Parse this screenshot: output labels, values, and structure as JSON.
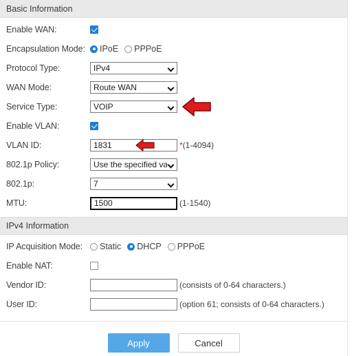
{
  "sections": {
    "basic": {
      "title": "Basic Information",
      "rows": {
        "enable_wan": {
          "label": "Enable WAN:",
          "checked": true
        },
        "encapsulation_mode": {
          "label": "Encapsulation Mode:",
          "options": [
            "IPoE",
            "PPPoE"
          ],
          "selected": "IPoE"
        },
        "protocol_type": {
          "label": "Protocol Type:",
          "value": "IPv4"
        },
        "wan_mode": {
          "label": "WAN Mode:",
          "value": "Route WAN"
        },
        "service_type": {
          "label": "Service Type:",
          "value": "VOIP"
        },
        "enable_vlan": {
          "label": "Enable VLAN:",
          "checked": true
        },
        "vlan_id": {
          "label": "VLAN ID:",
          "value": "1831",
          "asterisk": "*",
          "hint": "(1-4094)"
        },
        "dot1p_policy": {
          "label": "802.1p Policy:",
          "value": "Use the specified val"
        },
        "dot1p": {
          "label": "802.1p:",
          "value": "7"
        },
        "mtu": {
          "label": "MTU:",
          "value": "1500",
          "hint": "(1-1540)"
        }
      }
    },
    "ipv4": {
      "title": "IPv4 Information",
      "rows": {
        "ip_acquisition_mode": {
          "label": "IP Acquisition Mode:",
          "options": [
            "Static",
            "DHCP",
            "PPPoE"
          ],
          "selected": "DHCP"
        },
        "enable_nat": {
          "label": "Enable NAT:",
          "checked": false
        },
        "vendor_id": {
          "label": "Vendor ID:",
          "value": "",
          "hint": "(consists of 0-64 characters.)"
        },
        "user_id": {
          "label": "User ID:",
          "value": "",
          "hint": "(option 61; consists of 0-64 characters.)"
        }
      }
    }
  },
  "buttons": {
    "apply": "Apply",
    "cancel": "Cancel"
  },
  "annotations": {
    "service_type_arrow": "left-arrow-annotation",
    "vlan_id_arrow": "left-arrow-annotation"
  },
  "colors": {
    "accent": "#1b7fd4",
    "primary_button": "#54a8e8",
    "annotation_red": "#e01b1b",
    "section_header_bg": "#e9e9e9"
  }
}
